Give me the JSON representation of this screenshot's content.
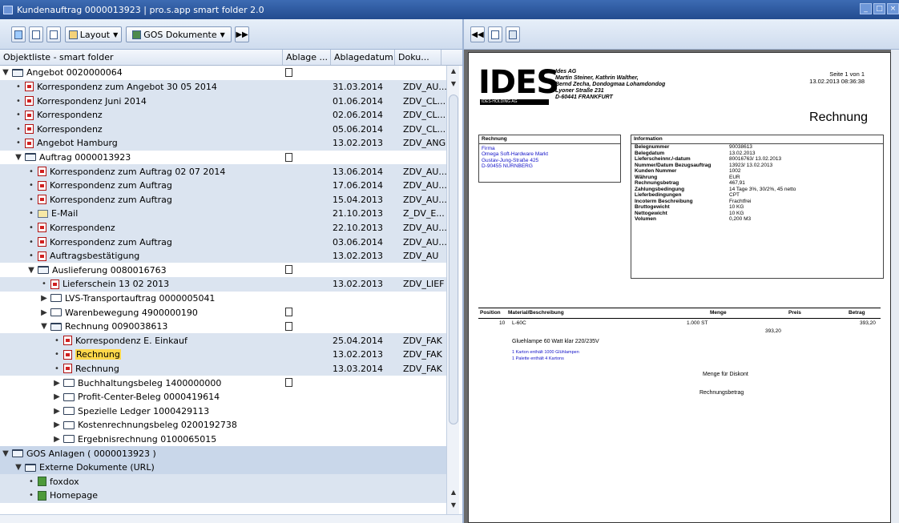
{
  "window": {
    "title": "Kundenauftrag 0000013923  |  pro.s.app smart folder 2.0",
    "controls": [
      "_",
      "□",
      "×"
    ]
  },
  "left_toolbar": {
    "layout_label": "Layout",
    "gos_label": "GOS Dokumente"
  },
  "tree": {
    "columns": [
      "Objektliste - smart folder",
      "Ablage ...",
      "Ablagedatum",
      "Doku..."
    ],
    "rows": [
      {
        "label": "Angebot 0020000064",
        "date": "",
        "doku": ""
      },
      {
        "label": "Korrespondenz zum Angebot 30 05 2014",
        "date": "31.03.2014",
        "doku": "ZDV_AU..."
      },
      {
        "label": "Korrespondenz Juni 2014",
        "date": "01.06.2014",
        "doku": "ZDV_CL..."
      },
      {
        "label": "Korrespondenz",
        "date": "02.06.2014",
        "doku": "ZDV_CL..."
      },
      {
        "label": "Korrespondenz",
        "date": "05.06.2014",
        "doku": "ZDV_CL..."
      },
      {
        "label": "Angebot Hamburg",
        "date": "13.02.2013",
        "doku": "ZDV_ANG"
      },
      {
        "label": "Auftrag 0000013923",
        "date": "",
        "doku": ""
      },
      {
        "label": "Korrespondenz zum Auftrag 02 07 2014",
        "date": "13.06.2014",
        "doku": "ZDV_AU..."
      },
      {
        "label": "Korrespondenz zum Auftrag",
        "date": "17.06.2014",
        "doku": "ZDV_AU..."
      },
      {
        "label": "Korrespondenz zum Auftrag",
        "date": "15.04.2013",
        "doku": "ZDV_AU..."
      },
      {
        "label": "E-Mail",
        "date": "21.10.2013",
        "doku": "Z_DV_E..."
      },
      {
        "label": "Korrespondenz",
        "date": "22.10.2013",
        "doku": "ZDV_AU..."
      },
      {
        "label": "Korrespondenz zum Auftrag",
        "date": "03.06.2014",
        "doku": "ZDV_AU..."
      },
      {
        "label": "Auftragsbestätigung",
        "date": "13.02.2013",
        "doku": "ZDV_AU"
      },
      {
        "label": "Auslieferung 0080016763",
        "date": "",
        "doku": ""
      },
      {
        "label": "Lieferschein 13 02 2013",
        "date": "13.02.2013",
        "doku": "ZDV_LIEF"
      },
      {
        "label": "LVS-Transportauftrag 0000005041",
        "date": "",
        "doku": ""
      },
      {
        "label": "Warenbewegung 4900000190",
        "date": "",
        "doku": ""
      },
      {
        "label": "Rechnung 0090038613",
        "date": "",
        "doku": ""
      },
      {
        "label": "Korrespondenz E. Einkauf",
        "date": "25.04.2014",
        "doku": "ZDV_FAK"
      },
      {
        "label": "Rechnung",
        "date": "13.02.2013",
        "doku": "ZDV_FAK"
      },
      {
        "label": "Rechnung",
        "date": "13.03.2014",
        "doku": "ZDV_FAK"
      },
      {
        "label": "Buchhaltungsbeleg 1400000000",
        "date": "",
        "doku": ""
      },
      {
        "label": "Profit-Center-Beleg 0000419614",
        "date": "",
        "doku": ""
      },
      {
        "label": "Spezielle Ledger 1000429113",
        "date": "",
        "doku": ""
      },
      {
        "label": "Kostenrechnungsbeleg 0200192738",
        "date": "",
        "doku": ""
      },
      {
        "label": "Ergebnisrechnung 0100065015",
        "date": "",
        "doku": ""
      },
      {
        "label": "GOS Anlagen ( 0000013923 )",
        "date": "",
        "doku": ""
      },
      {
        "label": "Externe Dokumente (URL)",
        "date": "",
        "doku": ""
      },
      {
        "label": "foxdox",
        "date": "",
        "doku": ""
      },
      {
        "label": "Homepage",
        "date": "",
        "doku": ""
      }
    ]
  },
  "document": {
    "logo": "IDES",
    "logo_sub": "IDES-HOLDING AG",
    "address": [
      "Ides AG",
      "Martin Steiner, Kathrin Walther,",
      "Bernd Zecha, Dondogmaa Lohamdondog",
      "Lyoner Straße 231",
      "D-60441 FRANKFURT"
    ],
    "page_info": [
      "Seite 1 von 1",
      "13.02.2013 08:36:38"
    ],
    "title": "Rechnung",
    "bill_to": {
      "header": "Rechnung",
      "lines": [
        "Firma",
        "Omega Soft-Hardware Markt",
        "Gustav-Jung-Straße 425",
        "D-90455 NURNBERG"
      ]
    },
    "information": {
      "header": "Information",
      "labels": [
        "Belegnummer",
        "Belegdatum",
        "Lieferscheinnr./-datum",
        "Nummer/Datum Bezugsauftrag",
        "Kunden Nummer",
        "Währung",
        "Rechnungsbetrag",
        "Zahlungsbedingung",
        "Lieferbedingungen",
        "Incoterm Beschreibung",
        "Bruttogewicht",
        "Nettogewicht",
        "Volumen"
      ],
      "values": [
        "90038613",
        "13.02.2013",
        "80016763/ 13.02.2013",
        "13923/ 13.02.2013",
        "1002",
        "EUR",
        "467,91",
        "14 Tage 3%, 30/2%, 45 netto",
        "CPT",
        "Frachtfrei",
        "10 KG",
        "10 KG",
        "0,200 M3"
      ]
    },
    "positions": {
      "headers": [
        "Position",
        "Material/Beschreibung",
        "Menge",
        "Preis",
        "Betrag"
      ],
      "pos": "10",
      "material": "L-60C",
      "qty": "1.000  ST",
      "price": "393,20",
      "amount": "393,20",
      "desc": "Gluehlampe 60 Watt klar 220/235V",
      "notes": [
        "1 Karton enthält 1000 Glühlampen",
        "1 Palette enthält 4 Kartons"
      ],
      "menge_diskont": "Menge für Diskont",
      "rechnungsbetrag": "Rechnungsbetrag"
    }
  }
}
